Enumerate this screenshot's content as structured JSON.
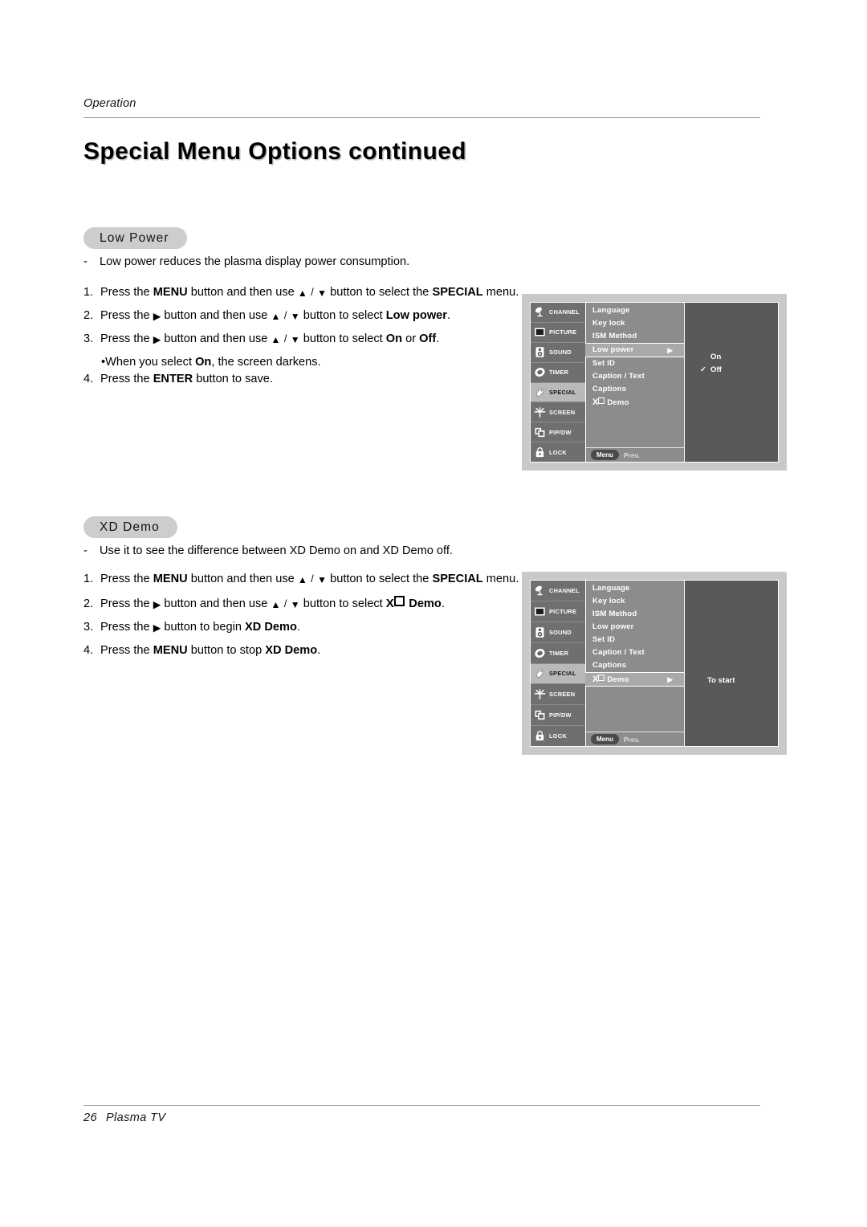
{
  "header": {
    "running_head": "Operation",
    "title": "Special Menu Options continued"
  },
  "footer": {
    "page_number": "26",
    "label": "Plasma TV"
  },
  "sections": [
    {
      "pill_label": "Low Power",
      "intro": "Low power reduces the plasma display power consumption.",
      "steps": [
        {
          "num": "1.",
          "a": "Press the ",
          "b1": "MENU",
          "c": " button and then use ",
          "arrows": true,
          "d": " button to select the ",
          "b2": "SPECIAL",
          "e": " menu."
        },
        {
          "num": "2.",
          "a": "Press the ",
          "tri": true,
          "c": " button and then use ",
          "arrows": true,
          "d": " button to select ",
          "b2": "Low power",
          "e": "."
        },
        {
          "num": "3.",
          "a": "Press the ",
          "tri": true,
          "c": " button and then use ",
          "arrows": true,
          "d": " button to select ",
          "b2": "On",
          "e": " or ",
          "b3": "Off",
          "f": "."
        }
      ],
      "substep": {
        "bullet": "•",
        "a": "When you select ",
        "b": "On",
        "c": ", the screen darkens."
      },
      "step4": {
        "num": "4.",
        "a": "Press the ",
        "b": "ENTER",
        "c": " button to save."
      }
    },
    {
      "pill_label": "XD Demo",
      "intro": "Use it to see the difference between XD Demo on and XD Demo off.",
      "steps": [
        {
          "num": "1.",
          "a": "Press the ",
          "b1": "MENU",
          "c": " button and then use ",
          "arrows": true,
          "d": " button to select the ",
          "b2": "SPECIAL",
          "e": " menu."
        },
        {
          "num": "2.",
          "a": "Press the ",
          "tri": true,
          "c": " button and then use ",
          "arrows": true,
          "d": " button to select ",
          "xd": "Demo",
          "e": "."
        },
        {
          "num": "3.",
          "a": "Press the ",
          "tri": true,
          "c": " button to begin ",
          "b2": "XD Demo",
          "e": "."
        },
        {
          "num": "4.",
          "a": "Press the ",
          "b1": "MENU",
          "c": " button to stop ",
          "b2": "XD Demo",
          "e": "."
        }
      ]
    }
  ],
  "osd": {
    "sidebar": [
      {
        "label": "CHANNEL",
        "icon": "satellite-dish-icon",
        "active": false
      },
      {
        "label": "PICTURE",
        "icon": "tv-screen-icon",
        "active": false
      },
      {
        "label": "SOUND",
        "icon": "speaker-icon",
        "active": false
      },
      {
        "label": "TIMER",
        "icon": "clock-icon",
        "active": false
      },
      {
        "label": "SPECIAL",
        "icon": "tag-icon",
        "active": true
      },
      {
        "label": "SCREEN",
        "icon": "crosshair-icon",
        "active": false
      },
      {
        "label": "PIP/DW",
        "icon": "pip-windows-icon",
        "active": false
      },
      {
        "label": "LOCK",
        "icon": "padlock-icon",
        "active": false
      }
    ],
    "menu_rows": [
      "Language",
      "Key lock",
      "ISM Method",
      "Low power",
      "Set ID",
      "Caption / Text",
      "Captions",
      "Demo"
    ],
    "footer": {
      "menu_chip": "Menu",
      "prev_label": "Prev."
    },
    "low_power_panel": {
      "selected_row": "Low power",
      "arrow": "▶",
      "options": [
        {
          "label": "On",
          "checked": false
        },
        {
          "label": "Off",
          "checked": true
        }
      ],
      "check_glyph": "✓"
    },
    "xd_demo_panel": {
      "selected_row": "Demo",
      "arrow": "▶",
      "status": "To start"
    }
  },
  "colors": {
    "pill_bg": "#cdcdcd",
    "osd_frame": "#c9c9c9",
    "osd_sidebar": "#6f6f6f",
    "osd_sidebar_active": "#b9b9b9",
    "osd_list": "#8c8c8c",
    "osd_row_selected": "#a9a9a9",
    "osd_right": "#595959",
    "rule": "#9a9a9a"
  }
}
